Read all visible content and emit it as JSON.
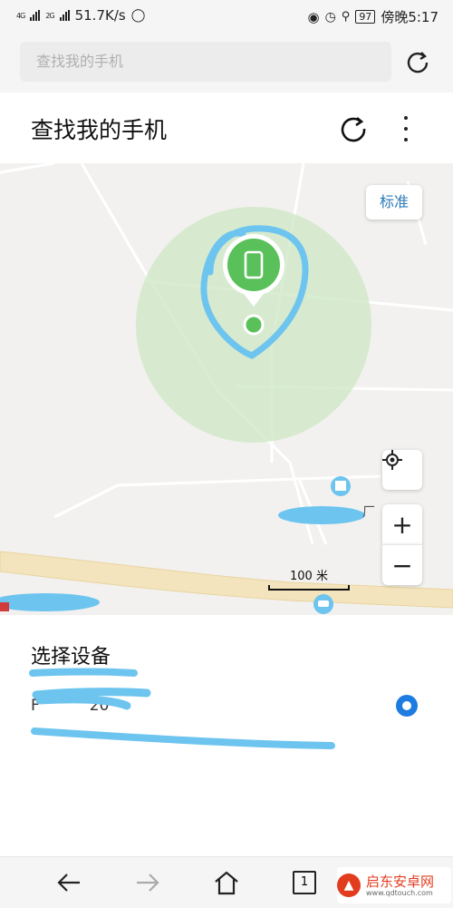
{
  "status_bar": {
    "net1": "4G",
    "net2": "2G",
    "speed": "51.7K/s",
    "battery": "97",
    "time": "傍晚5:17"
  },
  "browser": {
    "search_placeholder": "查找我的手机"
  },
  "header": {
    "title": "查找我的手机"
  },
  "map": {
    "standard_button": "标准",
    "scale_label": "100 米",
    "poi_fragment": "厂",
    "zoom_in": "+",
    "zoom_out": "−"
  },
  "device_panel": {
    "title": "选择设备",
    "device_name_prefix": "F",
    "device_name_suffix": "20"
  },
  "nav": {
    "tab_count": "1"
  },
  "watermark": {
    "name": "启东安卓网",
    "url": "www.qdtouch.com"
  },
  "colors": {
    "accent_blue": "#1e7be0",
    "map_circle": "#cfe8c7",
    "marker_green": "#5ac05a",
    "scribble_blue": "#6cc4ef"
  }
}
